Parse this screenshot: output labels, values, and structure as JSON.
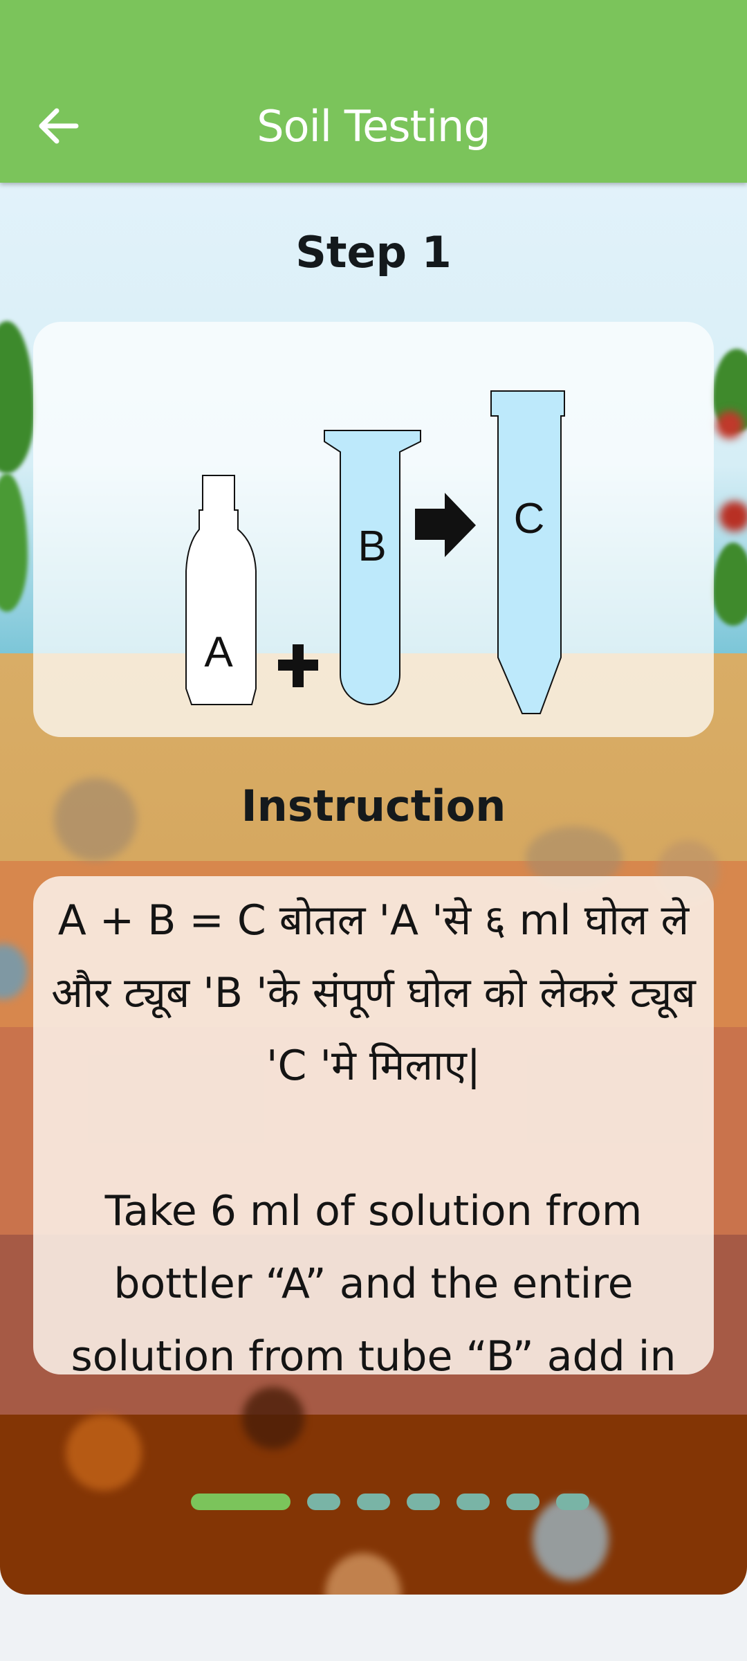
{
  "app_bar": {
    "title": "Soil Testing",
    "back_icon": "arrow-left-icon",
    "color": "#7bc45b"
  },
  "step": {
    "title": "Step 1",
    "illustration": {
      "items": [
        {
          "label": "A",
          "kind": "bottle",
          "fill": "#ffffff"
        },
        {
          "operator": "+"
        },
        {
          "label": "B",
          "kind": "test-tube",
          "fill": "#bde9fb"
        },
        {
          "operator": "arrow-right"
        },
        {
          "label": "C",
          "kind": "conical-tube",
          "fill": "#bde9fb"
        }
      ]
    }
  },
  "instruction": {
    "title": "Instruction",
    "hindi_text": "A + B = C  बोतल 'A 'से ६ ml घोल ले और ट्यूब 'B 'के संपूर्ण घोल को लेकरं ट्यूब 'C 'मे मिलाए|",
    "english_text": "Take 6 ml of solution from bottler “A” and the entire solution from tube “B” add in"
  },
  "pager": {
    "total": 7,
    "current": 1,
    "active_color": "#7bc45b",
    "inactive_color": "#79b4a6"
  }
}
